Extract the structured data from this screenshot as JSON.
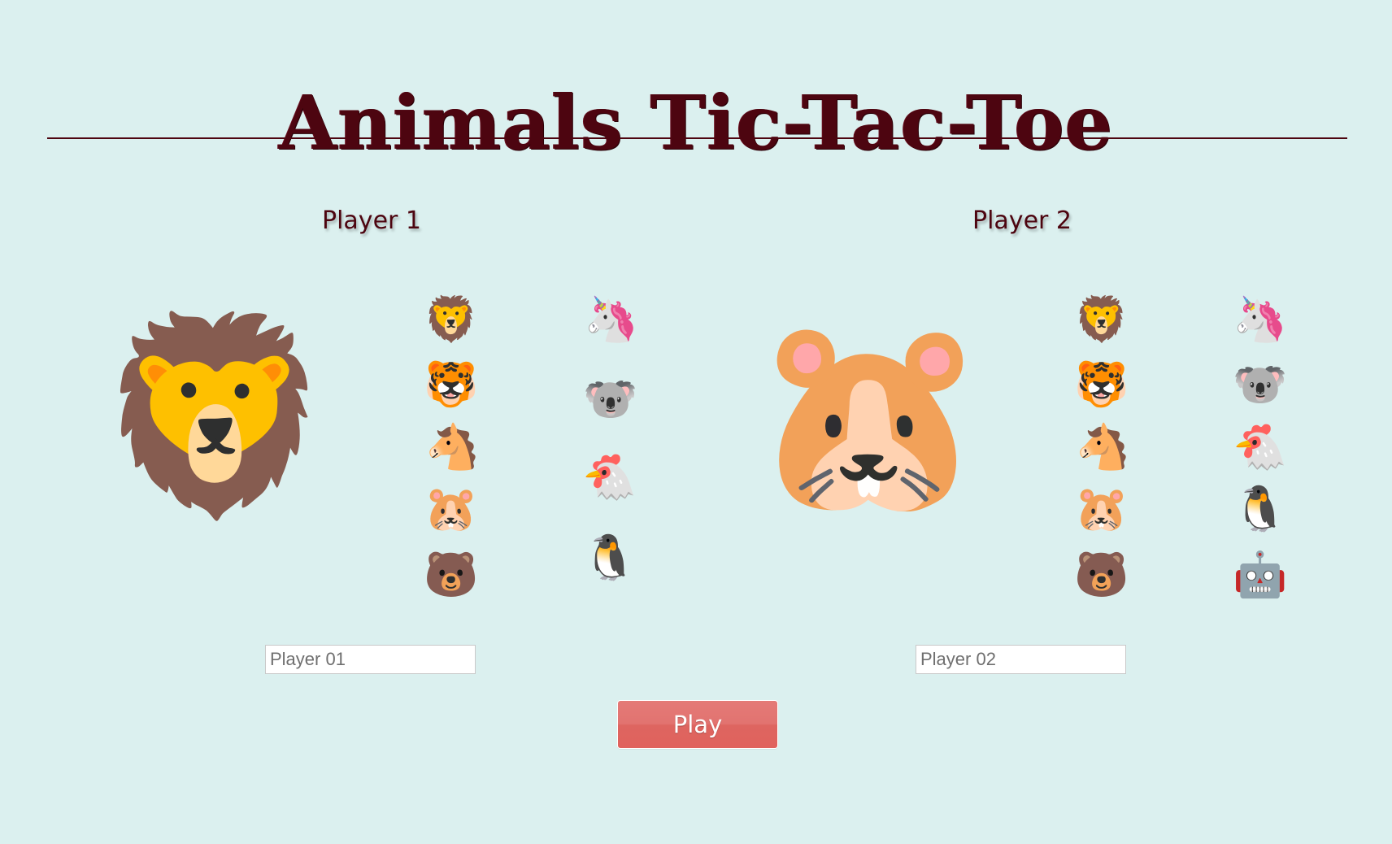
{
  "app": {
    "title": "Animals Tic-Tac-Toe"
  },
  "colors": {
    "background": "#dbf0ef",
    "title": "#4d0510",
    "play_button": "#e0625d"
  },
  "player1": {
    "heading": "Player 1",
    "selected_avatar": "🦁",
    "selected_avatar_icon": "lion-face-icon",
    "name_placeholder": "Player 01",
    "options": [
      "🦁",
      "🦄",
      "🐯",
      "🐨",
      "🐴",
      "🐔",
      "🐹",
      "🐧",
      "🐻"
    ],
    "option_icons": [
      "lion-face-icon",
      "unicorn-icon",
      "tiger-face-icon",
      "koala-icon",
      "horse-face-icon",
      "chicken-icon",
      "hamster-icon",
      "penguin-icon",
      "bear-icon"
    ]
  },
  "player2": {
    "heading": "Player 2",
    "selected_avatar": "🐹",
    "selected_avatar_icon": "hamster-icon",
    "name_placeholder": "Player 02",
    "options": [
      "🦁",
      "🦄",
      "🐯",
      "🐨",
      "🐴",
      "🐔",
      "🐹",
      "🐧",
      "🐻",
      "🤖"
    ],
    "option_icons": [
      "lion-face-icon",
      "unicorn-icon",
      "tiger-face-icon",
      "koala-icon",
      "horse-face-icon",
      "chicken-icon",
      "hamster-icon",
      "penguin-icon",
      "bear-icon",
      "robot-icon"
    ]
  },
  "actions": {
    "play_label": "Play"
  }
}
